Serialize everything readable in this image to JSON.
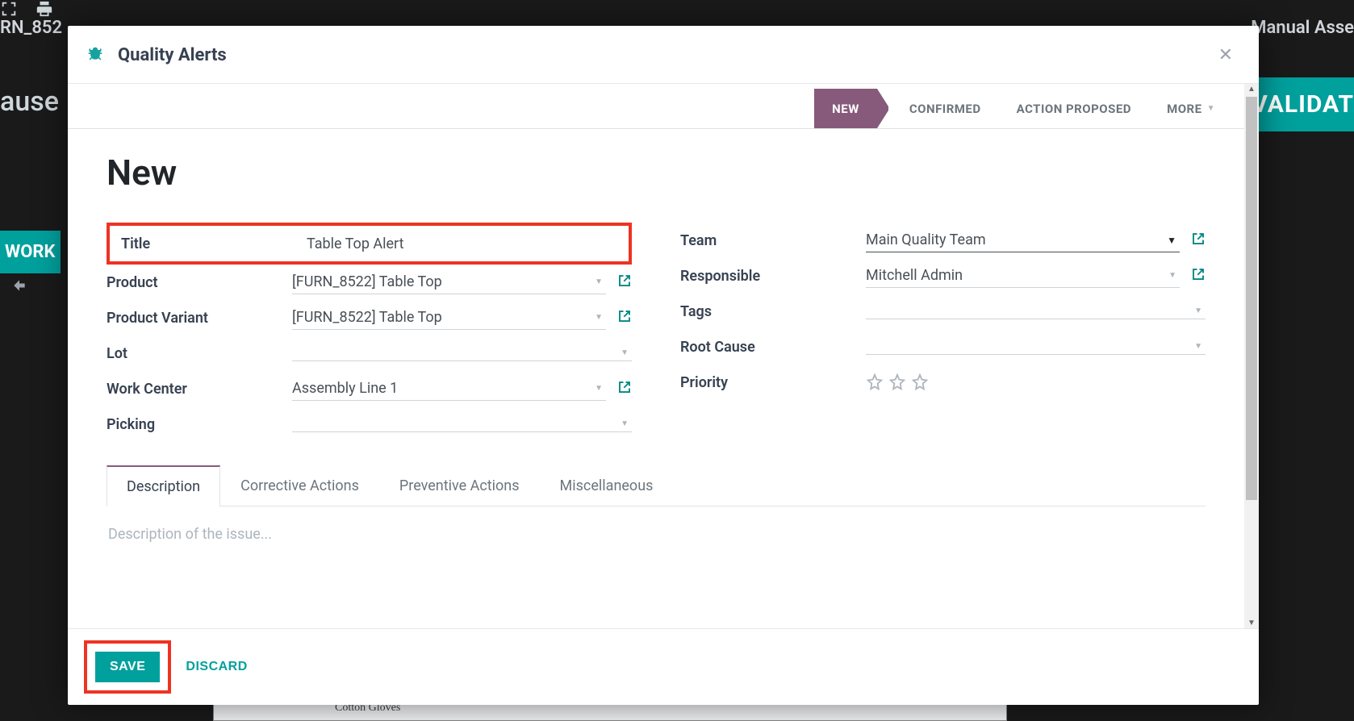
{
  "background": {
    "top_left": "RN_852",
    "top_right": "Manual Asse",
    "ause": "ause",
    "validate": "VALIDAT",
    "work": "WORK",
    "paper_text": "Cotton Gloves"
  },
  "modal": {
    "title": "Quality Alerts",
    "page_title": "New"
  },
  "status": {
    "new": "NEW",
    "confirmed": "CONFIRMED",
    "action_proposed": "ACTION PROPOSED",
    "more": "MORE"
  },
  "labels": {
    "title": "Title",
    "product": "Product",
    "product_variant": "Product Variant",
    "lot": "Lot",
    "work_center": "Work Center",
    "picking": "Picking",
    "team": "Team",
    "responsible": "Responsible",
    "tags": "Tags",
    "root_cause": "Root Cause",
    "priority": "Priority"
  },
  "values": {
    "title": "Table Top Alert",
    "product": "[FURN_8522] Table Top",
    "product_variant": "[FURN_8522] Table Top",
    "lot": "",
    "work_center": "Assembly Line 1",
    "picking": "",
    "team": "Main Quality Team",
    "responsible": "Mitchell Admin",
    "tags": "",
    "root_cause": ""
  },
  "tabs": {
    "description": "Description",
    "corrective": "Corrective Actions",
    "preventive": "Preventive Actions",
    "misc": "Miscellaneous",
    "description_placeholder": "Description of the issue..."
  },
  "footer": {
    "save": "SAVE",
    "discard": "DISCARD"
  }
}
